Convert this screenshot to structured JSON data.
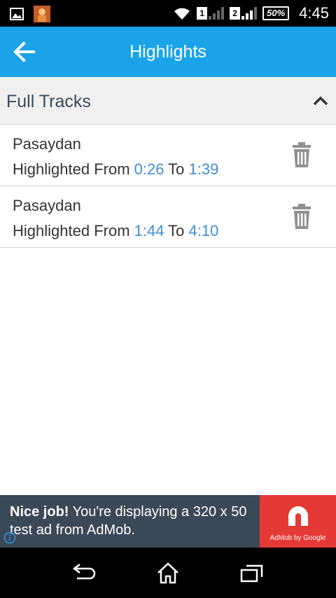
{
  "status_bar": {
    "sim1": "1",
    "sim2": "2",
    "battery": "50%",
    "time": "4:45",
    "icons": [
      "image-icon",
      "app-thumbnail-icon",
      "wifi-icon",
      "signal-icon",
      "battery-icon"
    ]
  },
  "app_bar": {
    "title": "Highlights",
    "back_icon": "arrow-left-icon",
    "color": "#1aa3e8"
  },
  "section": {
    "title": "Full Tracks",
    "collapse_icon": "chevron-up-icon"
  },
  "tracks": [
    {
      "name": "Pasaydan",
      "prefix": "Highlighted From ",
      "from": "0:26",
      "to_label": " To ",
      "to": "1:39",
      "delete_icon": "trash-icon"
    },
    {
      "name": "Pasaydan",
      "prefix": "Highlighted From ",
      "from": "1:44",
      "to_label": " To ",
      "to": "4:10",
      "delete_icon": "trash-icon"
    }
  ],
  "ad": {
    "headline": "Nice job!",
    "body": " You're displaying a 320 x 50 test ad from AdMob.",
    "logo_text": "AdMob by Google",
    "accent": "#e53935"
  },
  "nav_bar": {
    "icons": [
      "back-icon",
      "home-icon",
      "recents-icon"
    ]
  },
  "colors": {
    "time_link": "#3d8fd6",
    "ad_background": "#3b4856"
  }
}
